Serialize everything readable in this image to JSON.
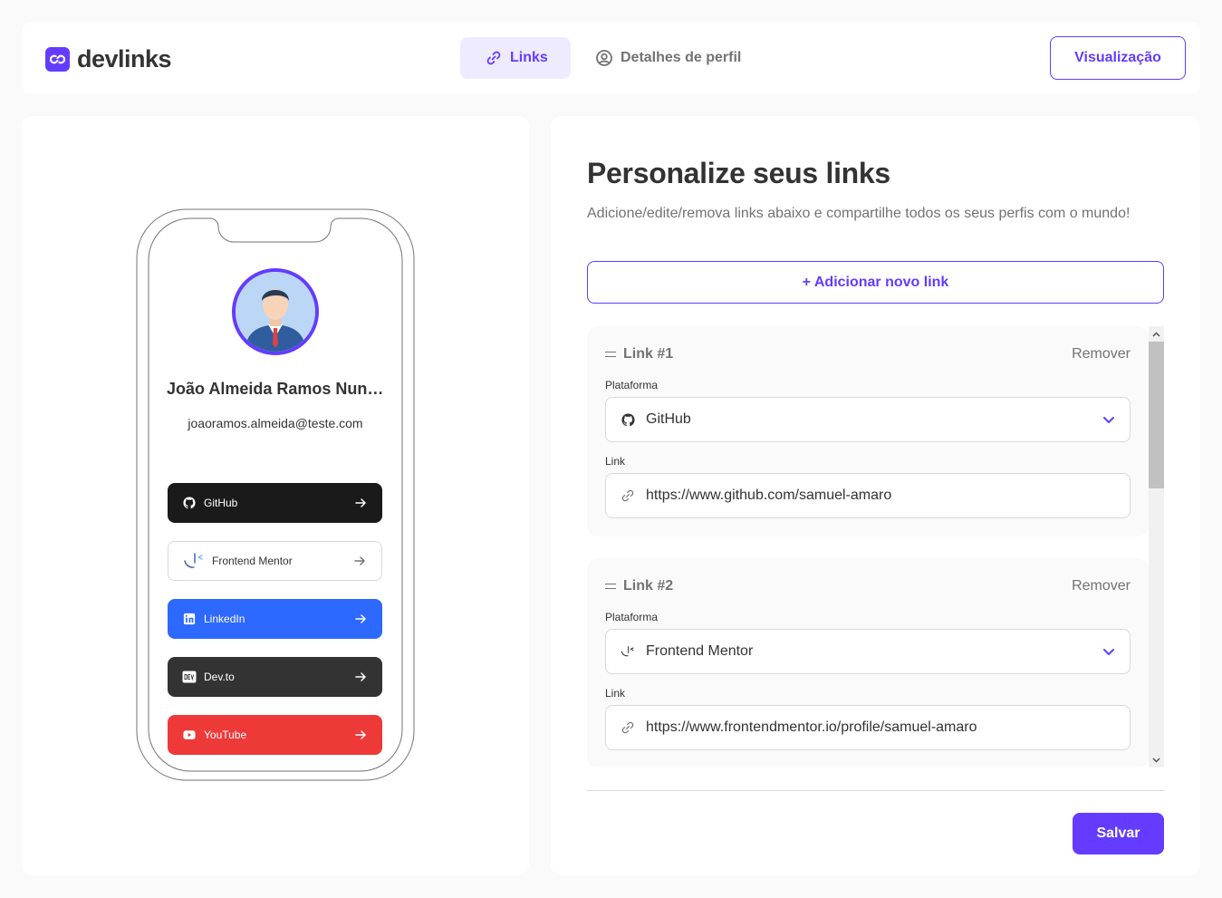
{
  "app": {
    "logo_text": "devlinks"
  },
  "header": {
    "tabs": [
      {
        "label": "Links",
        "icon": "link-icon",
        "active": true
      },
      {
        "label": "Detalhes de perfil",
        "icon": "user-circle-icon",
        "active": false
      }
    ],
    "preview_label": "Visualização"
  },
  "preview": {
    "name": "João Almeida Ramos Nunes",
    "email": "joaoramos.almeida@teste.com",
    "links": [
      {
        "label": "GitHub",
        "icon": "github-icon",
        "color": "#1a1a1a",
        "text_color": "#ffffff"
      },
      {
        "label": "Frontend Mentor",
        "icon": "frontend-mentor-icon",
        "color": "#ffffff",
        "text_color": "#333333"
      },
      {
        "label": "LinkedIn",
        "icon": "linkedin-icon",
        "color": "#2d68ff",
        "text_color": "#ffffff"
      },
      {
        "label": "Dev.to",
        "icon": "devto-icon",
        "color": "#333333",
        "text_color": "#ffffff"
      },
      {
        "label": "YouTube",
        "icon": "youtube-icon",
        "color": "#ee3939",
        "text_color": "#ffffff"
      }
    ]
  },
  "editor": {
    "title": "Personalize seus links",
    "subtitle": "Adicione/edite/remova links abaixo e compartilhe todos os seus perfis com o mundo!",
    "add_label": "+ Adicionar novo link",
    "links": [
      {
        "title": "Link #1",
        "remove_label": "Remover",
        "platform_label": "Plataforma",
        "platform": "GitHub",
        "platform_icon": "github-icon",
        "link_label": "Link",
        "url": "https://www.github.com/samuel-amaro"
      },
      {
        "title": "Link #2",
        "remove_label": "Remover",
        "platform_label": "Plataforma",
        "platform": "Frontend Mentor",
        "platform_icon": "frontend-mentor-icon",
        "link_label": "Link",
        "url": "https://www.frontendmentor.io/profile/samuel-amaro"
      }
    ],
    "save_label": "Salvar"
  },
  "colors": {
    "accent": "#633cff",
    "accent_light": "#efebff",
    "text": "#333333",
    "muted": "#737373",
    "border": "#d9d9d9"
  }
}
